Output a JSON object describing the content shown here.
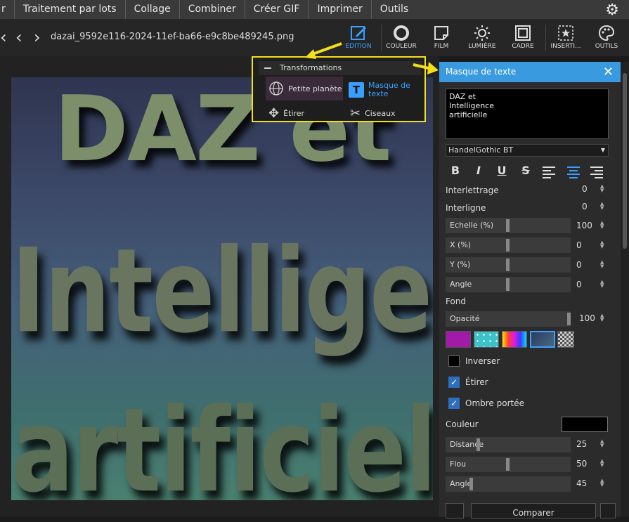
{
  "menu": [
    "r",
    "Traitement par lots",
    "Collage",
    "Combiner",
    "Créer GIF",
    "Imprimer",
    "Outils"
  ],
  "filename": "dazai_9592e116-2024-11ef-ba66-e9c8be489245.png",
  "tools": [
    {
      "label": "EDITION",
      "icon": "edit-icon"
    },
    {
      "label": "COULEUR",
      "icon": "circle-icon"
    },
    {
      "label": "FILM",
      "icon": "film-icon"
    },
    {
      "label": "LUMIÈRE",
      "icon": "sun-icon"
    },
    {
      "label": "CADRE",
      "icon": "frame-icon"
    },
    {
      "label": "INSERTI...",
      "icon": "insert-star-icon"
    },
    {
      "label": "OUTILS",
      "icon": "palette-icon"
    }
  ],
  "image_text": [
    "DAZ et",
    "Intelligence",
    "artificielle"
  ],
  "popup": {
    "title": "Transformations",
    "items": [
      "Petite planète",
      "Masque de texte",
      "Étirer",
      "Ciseaux"
    ]
  },
  "panel": {
    "title": "Masque de texte",
    "text_value": "DAZ et\nIntelligence\nartificielle",
    "font": "HandelGothic BT",
    "interlettrage_label": "Interlettrage",
    "interlettrage": "0",
    "interligne_label": "Interligne",
    "interligne": "0",
    "echelle_label": "Echelle (%)",
    "echelle": "100",
    "x_label": "X (%)",
    "x": "0",
    "y_label": "Y (%)",
    "y": "0",
    "angle_label": "Angle",
    "angle": "0",
    "fond_label": "Fond",
    "opacite_label": "Opacité",
    "opacite": "100",
    "inverser_label": "Inverser",
    "etirer_label": "Étirer",
    "ombre_label": "Ombre portée",
    "couleur_label": "Couleur",
    "distance_label": "Distance",
    "distance": "25",
    "flou_label": "Flou",
    "flou": "50",
    "angle2_label": "Angle",
    "angle2": "45",
    "compare_label": "Comparer",
    "swatch_colors": [
      "#a21aa8",
      "#3fc1c9",
      "#e8336b",
      "#2d3b5c",
      "#888888"
    ]
  },
  "colors": {
    "accent": "#3aa0ff",
    "header": "#3a9ae0",
    "highlight": "#f2e01b"
  }
}
